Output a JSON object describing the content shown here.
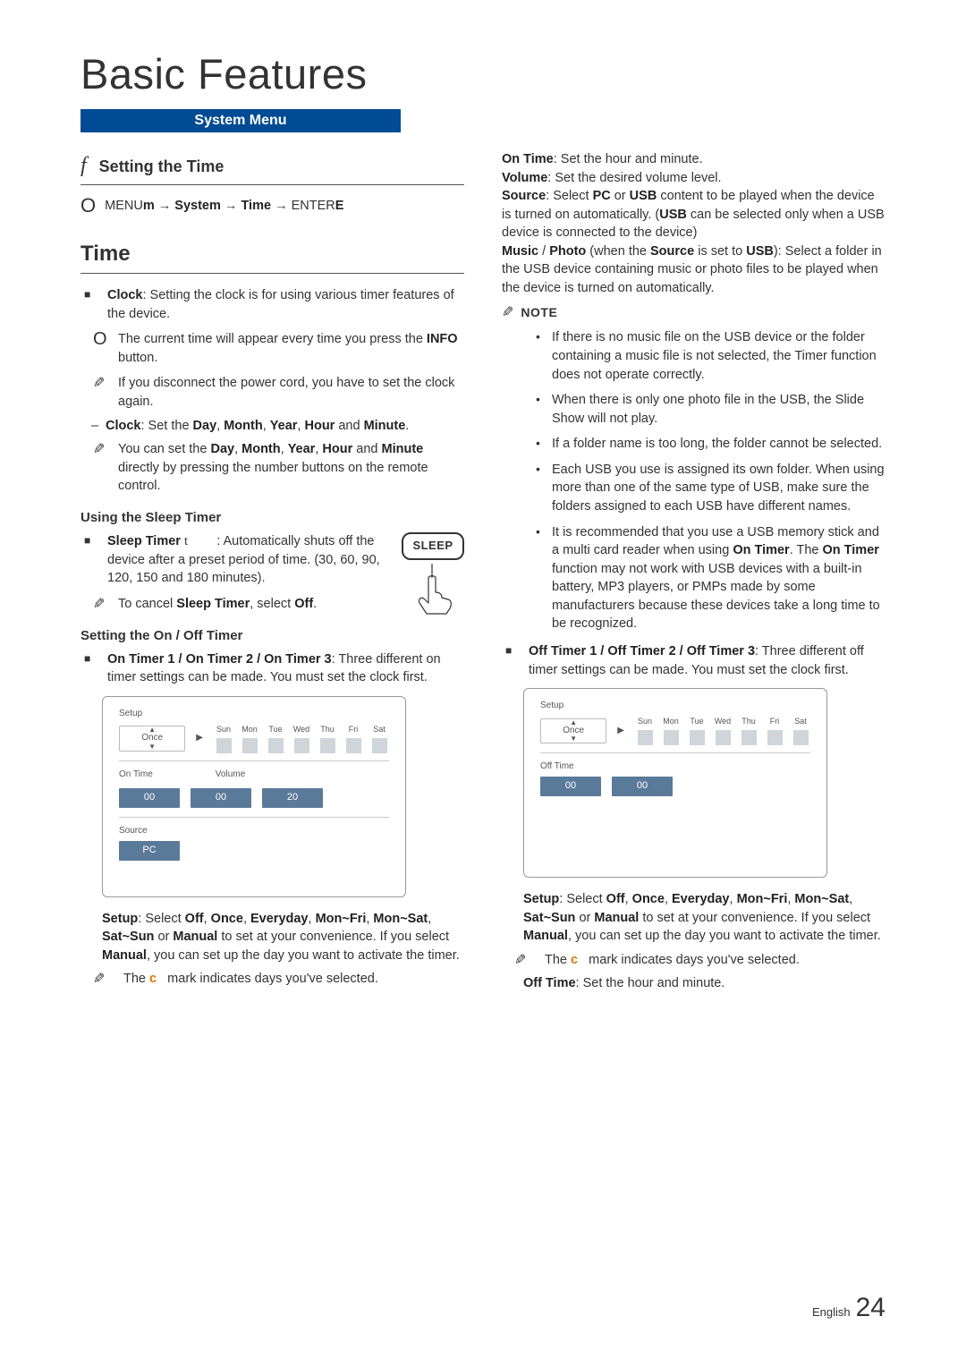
{
  "page_title": "Basic Features",
  "system_menu": "System Menu",
  "setting_time": {
    "symbol": "f",
    "title": "Setting the Time"
  },
  "nav": {
    "symbol": "O",
    "path_html": "MENU<b>m</b> → <b>System</b> → <b>Time</b> → ENTER<b>E</b>"
  },
  "time_heading": "Time",
  "clock_intro_html": "<b>Clock</b>: Setting the clock is for using various timer features of the device.",
  "clock_note1": {
    "symbol": "O",
    "text_html": "The current time will appear every time you press the <b>INFO</b> button."
  },
  "clock_note2": {
    "text_html": "If you disconnect the power cord, you have to set the clock again."
  },
  "clock_sub": {
    "text_html": "<b>Clock</b>: Set the <b>Day</b>, <b>Month</b>, <b>Year</b>, <b>Hour</b> and <b>Minute</b>."
  },
  "clock_note3": {
    "text_html": "You can set the <b>Day</b>, <b>Month</b>, <b>Year</b>, <b>Hour</b> and <b>Minute</b> directly by pressing the number buttons on the remote control."
  },
  "sleep_heading": "Using the Sleep Timer",
  "sleep_text_html": "<b>Sleep Timer</b> <span style='font-family:Georgia,serif'>t</span>&nbsp;&nbsp;&nbsp;&nbsp;&nbsp;&nbsp;&nbsp;&nbsp;: Automatically shuts off the device after a preset period of time. (30, 60, 90, 120, 150 and 180 minutes).",
  "sleep_cancel_html": "To cancel <b>Sleep Timer</b>, select <b>Off</b>.",
  "sleep_button": "SLEEP",
  "onoff_heading": "Setting the On / Off Timer",
  "on_timer_intro_html": "<b>On Timer 1 / On Timer 2 / On Timer 3</b>: Three different on timer settings can be made. You must set the clock first.",
  "off_timer_intro_html": "<b>Off Timer 1 / Off Timer 2 / Off Timer 3</b>: Three different off timer settings can be made. You must set the clock first.",
  "panel_on": {
    "setup": "Setup",
    "once": "Once",
    "days": [
      "Sun",
      "Mon",
      "Tue",
      "Wed",
      "Thu",
      "Fri",
      "Sat"
    ],
    "on_time_label": "On Time",
    "volume_label": "Volume",
    "hour": "00",
    "minute": "00",
    "volume": "20",
    "source_label": "Source",
    "source_value": "PC"
  },
  "panel_off": {
    "setup": "Setup",
    "once": "Once",
    "days": [
      "Sun",
      "Mon",
      "Tue",
      "Wed",
      "Thu",
      "Fri",
      "Sat"
    ],
    "off_time_label": "Off Time",
    "hour": "00",
    "minute": "00"
  },
  "setup_desc_html": "<b>Setup</b>: Select <b>Off</b>, <b>Once</b>, <b>Everyday</b>, <b>Mon~Fri</b>, <b>Mon~Sat</b>, <b>Sat~Sun</b> or <b>Manual</b> to set at your convenience. If you select <b>Manual</b>, you can set up the day you want to activate the timer.",
  "c_mark_note_html": "The <span class='c-mark'>c</span>&nbsp;&nbsp;&nbsp;mark indicates days you've selected.",
  "on_time_desc_html": "<b>On Time</b>: Set the hour and  minute.",
  "volume_desc_html": "<b>Volume</b>: Set the desired volume level.",
  "source_desc_html": "<b>Source</b>: Select <b>PC</b> or <b>USB</b> content to be played when the device is turned on automatically. (<b>USB</b> can be selected only when a USB device is connected to the device)",
  "music_desc_html": "<b>Music</b> / <b>Photo</b> (when the <b>Source</b> is set to <b>USB</b>): Select a folder in the USB device containing music or photo files to be played when the device is turned on automatically.",
  "note_label": "NOTE",
  "notes": [
    "If there is no music file on the USB device or the folder containing a music file is not selected, the Timer function does not operate correctly.",
    "When there is only one photo file in the USB, the Slide Show will not play.",
    "If a folder name is too long, the folder cannot be selected.",
    "Each USB you use is assigned its own folder. When using more than one of the same type of USB, make sure the folders assigned to each USB have different names.",
    "It is recommended that you use a USB memory stick and a multi card reader when using <b>On Timer</b>. The <b>On Timer</b> function may not work with USB devices with a built-in battery, MP3 players, or PMPs made by some manufacturers because these devices take a long time to be recognized."
  ],
  "off_time_desc_html": "<b>Off Time</b>: Set the hour and minute.",
  "footer": {
    "lang": "English",
    "page": "24"
  }
}
